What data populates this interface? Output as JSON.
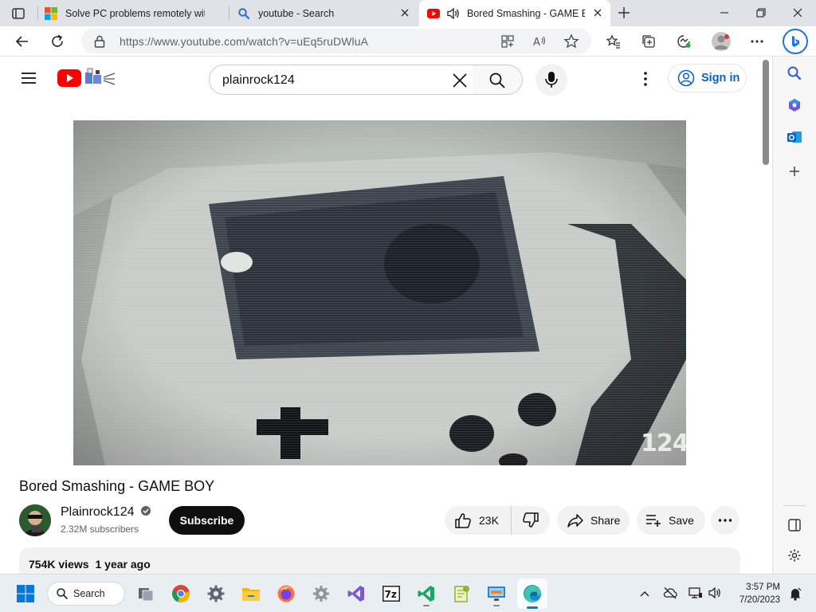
{
  "browser": {
    "tabs": [
      {
        "title": "Solve PC problems remotely with",
        "favicon": "microsoft-logo-icon",
        "active": false
      },
      {
        "title": "youtube - Search",
        "favicon": "search-icon",
        "active": false
      },
      {
        "title": "Bored Smashing - GAME BC",
        "favicon": "youtube-icon",
        "active": true,
        "audio": true
      }
    ],
    "url": "https://www.youtube.com/watch?v=uEq5ruDWluA"
  },
  "youtube": {
    "search_query": "plainrock124",
    "signin_label": "Sign in",
    "video": {
      "watermark": "124",
      "title": "Bored Smashing - GAME BOY"
    },
    "channel": {
      "name": "Plainrock124",
      "subscribers": "2.32M subscribers",
      "subscribe_label": "Subscribe"
    },
    "actions": {
      "likes": "23K",
      "share_label": "Share",
      "save_label": "Save"
    },
    "description": {
      "views": "754K views",
      "age": "1 year ago"
    }
  },
  "taskbar": {
    "search_label": "Search",
    "time": "3:57 PM",
    "date": "7/20/2023"
  },
  "colors": {
    "youtube_red": "#ff0000",
    "link_blue": "#065fd4",
    "edge_accent": "#0078d4"
  }
}
